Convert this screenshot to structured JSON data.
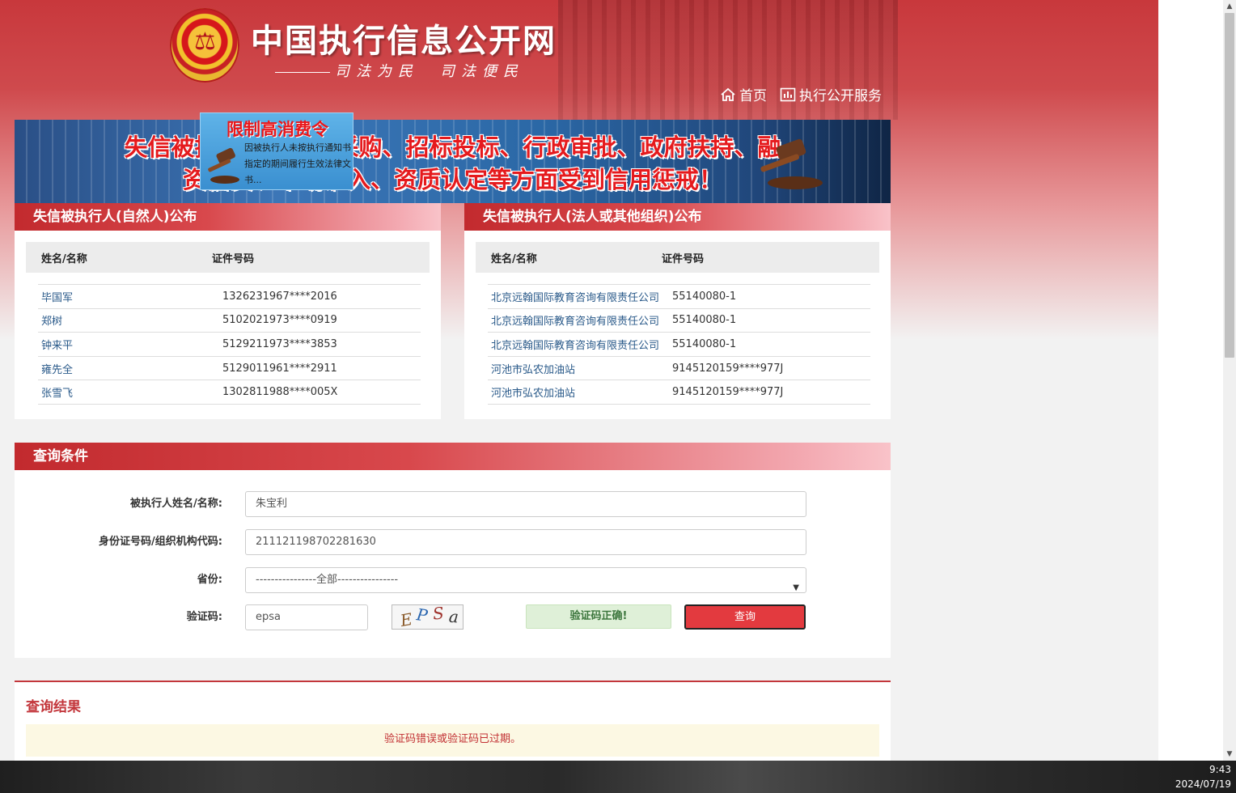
{
  "header": {
    "site_title": "中国执行信息公开网",
    "slogan": "司法为民　司法便民",
    "nav": [
      {
        "label": "首页",
        "icon": "home-icon"
      },
      {
        "label": "执行公开服务",
        "icon": "chart-icon"
      }
    ]
  },
  "banner": {
    "line1": "失信被执行人在政府采购、招标投标、行政审批、政府扶持、融",
    "line2": "资信贷、市场准入、资质认定等方面受到信用惩戒！",
    "popup_title": "限制高消费令",
    "popup_body": "因被执行人未按执行通知书指定的期间履行生效法律文书..."
  },
  "left_panel": {
    "title": "失信被执行人(自然人)公布",
    "col_name": "姓名/名称",
    "col_id": "证件号码",
    "rows": [
      {
        "name": "毕国军",
        "id": "1326231967****2016"
      },
      {
        "name": "郑树",
        "id": "5102021973****0919"
      },
      {
        "name": "钟来平",
        "id": "5129211973****3853"
      },
      {
        "name": "雍先全",
        "id": "5129011961****2911"
      },
      {
        "name": "张雪飞",
        "id": "1302811988****005X"
      }
    ]
  },
  "right_panel": {
    "title": "失信被执行人(法人或其他组织)公布",
    "col_name": "姓名/名称",
    "col_id": "证件号码",
    "rows": [
      {
        "name": "北京远翰国际教育咨询有限责任公司",
        "id": "55140080-1"
      },
      {
        "name": "北京远翰国际教育咨询有限责任公司",
        "id": "55140080-1"
      },
      {
        "name": "北京远翰国际教育咨询有限责任公司",
        "id": "55140080-1"
      },
      {
        "name": "河池市弘农加油站",
        "id": "9145120159****977J"
      },
      {
        "name": "河池市弘农加油站",
        "id": "9145120159****977J"
      }
    ]
  },
  "query": {
    "title": "查询条件",
    "name_label": "被执行人姓名/名称:",
    "name_value": "朱宝利",
    "id_label": "身份证号码/组织机构代码:",
    "id_value": "211121198702281630",
    "province_label": "省份:",
    "province_value": "----------------全部----------------",
    "captcha_label": "验证码:",
    "captcha_value": "epsa",
    "captcha_chars": [
      "E",
      "P",
      "S",
      "a"
    ],
    "captcha_status": "验证码正确!",
    "submit_label": "查询"
  },
  "result": {
    "title": "查询结果",
    "message": "验证码错误或验证码已过期。"
  },
  "taskbar": {
    "time": "9:43",
    "date": "2024/07/19"
  },
  "colors": {
    "brand_red": "#c8383c",
    "link_blue": "#2a5a8a",
    "success_green": "#3c763d",
    "button_red": "#e33a3f"
  }
}
